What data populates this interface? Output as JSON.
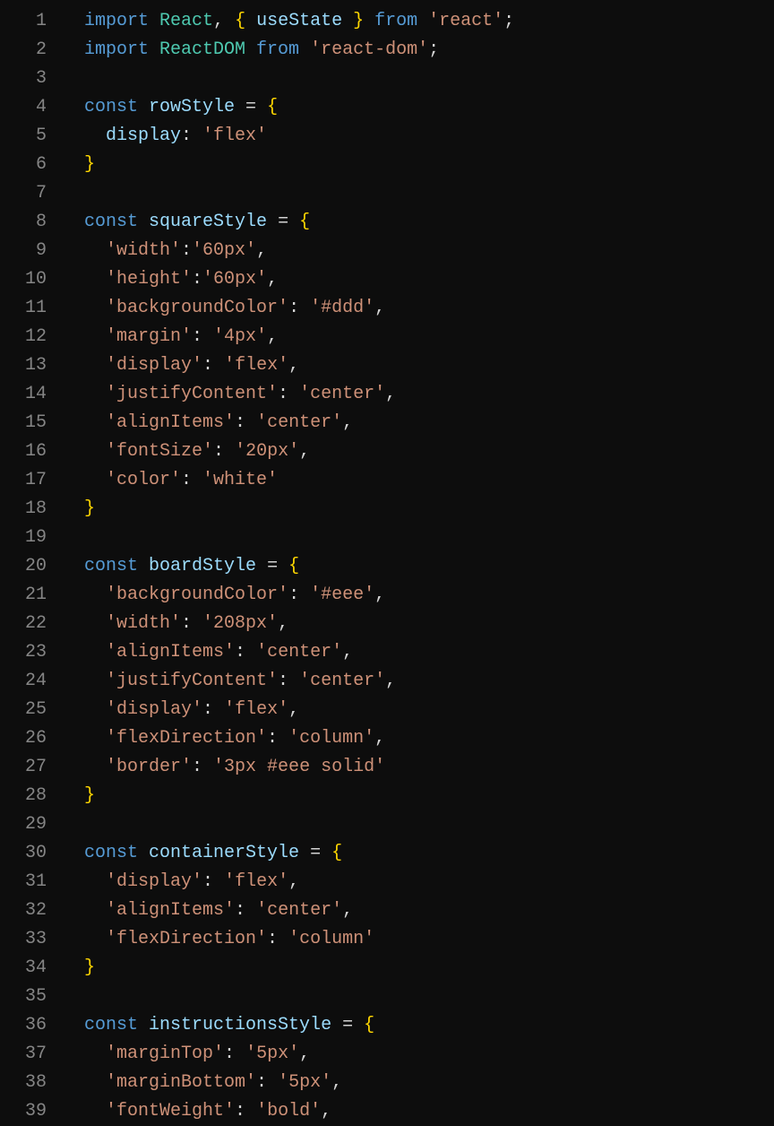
{
  "lines": [
    {
      "n": 1,
      "indent": 0,
      "tokens": [
        {
          "t": "import ",
          "c": "keyword"
        },
        {
          "t": "React",
          "c": "type"
        },
        {
          "t": ", ",
          "c": "punct"
        },
        {
          "t": "{ ",
          "c": "brace"
        },
        {
          "t": "useState",
          "c": "var"
        },
        {
          "t": " }",
          "c": "brace"
        },
        {
          "t": " from ",
          "c": "keyword"
        },
        {
          "t": "'react'",
          "c": "string"
        },
        {
          "t": ";",
          "c": "punct"
        }
      ]
    },
    {
      "n": 2,
      "indent": 0,
      "tokens": [
        {
          "t": "import ",
          "c": "keyword"
        },
        {
          "t": "ReactDOM",
          "c": "type"
        },
        {
          "t": " from ",
          "c": "keyword"
        },
        {
          "t": "'react-dom'",
          "c": "string"
        },
        {
          "t": ";",
          "c": "punct"
        }
      ]
    },
    {
      "n": 3,
      "indent": 0,
      "tokens": []
    },
    {
      "n": 4,
      "indent": 0,
      "tokens": [
        {
          "t": "const ",
          "c": "keyword"
        },
        {
          "t": "rowStyle",
          "c": "var"
        },
        {
          "t": " = ",
          "c": "punct"
        },
        {
          "t": "{",
          "c": "brace"
        }
      ]
    },
    {
      "n": 5,
      "indent": 1,
      "tokens": [
        {
          "t": "display",
          "c": "prop"
        },
        {
          "t": ": ",
          "c": "punct"
        },
        {
          "t": "'flex'",
          "c": "string"
        }
      ]
    },
    {
      "n": 6,
      "indent": 0,
      "tokens": [
        {
          "t": "}",
          "c": "brace"
        }
      ]
    },
    {
      "n": 7,
      "indent": 0,
      "tokens": []
    },
    {
      "n": 8,
      "indent": 0,
      "tokens": [
        {
          "t": "const ",
          "c": "keyword"
        },
        {
          "t": "squareStyle",
          "c": "var"
        },
        {
          "t": " = ",
          "c": "punct"
        },
        {
          "t": "{",
          "c": "brace"
        }
      ]
    },
    {
      "n": 9,
      "indent": 1,
      "tokens": [
        {
          "t": "'width'",
          "c": "string"
        },
        {
          "t": ":",
          "c": "punct"
        },
        {
          "t": "'60px'",
          "c": "string"
        },
        {
          "t": ",",
          "c": "punct"
        }
      ]
    },
    {
      "n": 10,
      "indent": 1,
      "tokens": [
        {
          "t": "'height'",
          "c": "string"
        },
        {
          "t": ":",
          "c": "punct"
        },
        {
          "t": "'60px'",
          "c": "string"
        },
        {
          "t": ",",
          "c": "punct"
        }
      ]
    },
    {
      "n": 11,
      "indent": 1,
      "tokens": [
        {
          "t": "'backgroundColor'",
          "c": "string"
        },
        {
          "t": ": ",
          "c": "punct"
        },
        {
          "t": "'#ddd'",
          "c": "string"
        },
        {
          "t": ",",
          "c": "punct"
        }
      ]
    },
    {
      "n": 12,
      "indent": 1,
      "tokens": [
        {
          "t": "'margin'",
          "c": "string"
        },
        {
          "t": ": ",
          "c": "punct"
        },
        {
          "t": "'4px'",
          "c": "string"
        },
        {
          "t": ",",
          "c": "punct"
        }
      ]
    },
    {
      "n": 13,
      "indent": 1,
      "tokens": [
        {
          "t": "'display'",
          "c": "string"
        },
        {
          "t": ": ",
          "c": "punct"
        },
        {
          "t": "'flex'",
          "c": "string"
        },
        {
          "t": ",",
          "c": "punct"
        }
      ]
    },
    {
      "n": 14,
      "indent": 1,
      "tokens": [
        {
          "t": "'justifyContent'",
          "c": "string"
        },
        {
          "t": ": ",
          "c": "punct"
        },
        {
          "t": "'center'",
          "c": "string"
        },
        {
          "t": ",",
          "c": "punct"
        }
      ]
    },
    {
      "n": 15,
      "indent": 1,
      "tokens": [
        {
          "t": "'alignItems'",
          "c": "string"
        },
        {
          "t": ": ",
          "c": "punct"
        },
        {
          "t": "'center'",
          "c": "string"
        },
        {
          "t": ",",
          "c": "punct"
        }
      ]
    },
    {
      "n": 16,
      "indent": 1,
      "tokens": [
        {
          "t": "'fontSize'",
          "c": "string"
        },
        {
          "t": ": ",
          "c": "punct"
        },
        {
          "t": "'20px'",
          "c": "string"
        },
        {
          "t": ",",
          "c": "punct"
        }
      ]
    },
    {
      "n": 17,
      "indent": 1,
      "tokens": [
        {
          "t": "'color'",
          "c": "string"
        },
        {
          "t": ": ",
          "c": "punct"
        },
        {
          "t": "'white'",
          "c": "string"
        }
      ]
    },
    {
      "n": 18,
      "indent": 0,
      "tokens": [
        {
          "t": "}",
          "c": "brace"
        }
      ]
    },
    {
      "n": 19,
      "indent": 0,
      "tokens": []
    },
    {
      "n": 20,
      "indent": 0,
      "tokens": [
        {
          "t": "const ",
          "c": "keyword"
        },
        {
          "t": "boardStyle",
          "c": "var"
        },
        {
          "t": " = ",
          "c": "punct"
        },
        {
          "t": "{",
          "c": "brace"
        }
      ]
    },
    {
      "n": 21,
      "indent": 1,
      "tokens": [
        {
          "t": "'backgroundColor'",
          "c": "string"
        },
        {
          "t": ": ",
          "c": "punct"
        },
        {
          "t": "'#eee'",
          "c": "string"
        },
        {
          "t": ",",
          "c": "punct"
        }
      ]
    },
    {
      "n": 22,
      "indent": 1,
      "tokens": [
        {
          "t": "'width'",
          "c": "string"
        },
        {
          "t": ": ",
          "c": "punct"
        },
        {
          "t": "'208px'",
          "c": "string"
        },
        {
          "t": ",",
          "c": "punct"
        }
      ]
    },
    {
      "n": 23,
      "indent": 1,
      "tokens": [
        {
          "t": "'alignItems'",
          "c": "string"
        },
        {
          "t": ": ",
          "c": "punct"
        },
        {
          "t": "'center'",
          "c": "string"
        },
        {
          "t": ",",
          "c": "punct"
        }
      ]
    },
    {
      "n": 24,
      "indent": 1,
      "tokens": [
        {
          "t": "'justifyContent'",
          "c": "string"
        },
        {
          "t": ": ",
          "c": "punct"
        },
        {
          "t": "'center'",
          "c": "string"
        },
        {
          "t": ",",
          "c": "punct"
        }
      ]
    },
    {
      "n": 25,
      "indent": 1,
      "tokens": [
        {
          "t": "'display'",
          "c": "string"
        },
        {
          "t": ": ",
          "c": "punct"
        },
        {
          "t": "'flex'",
          "c": "string"
        },
        {
          "t": ",",
          "c": "punct"
        }
      ]
    },
    {
      "n": 26,
      "indent": 1,
      "tokens": [
        {
          "t": "'flexDirection'",
          "c": "string"
        },
        {
          "t": ": ",
          "c": "punct"
        },
        {
          "t": "'column'",
          "c": "string"
        },
        {
          "t": ",",
          "c": "punct"
        }
      ]
    },
    {
      "n": 27,
      "indent": 1,
      "tokens": [
        {
          "t": "'border'",
          "c": "string"
        },
        {
          "t": ": ",
          "c": "punct"
        },
        {
          "t": "'3px #eee solid'",
          "c": "string"
        }
      ]
    },
    {
      "n": 28,
      "indent": 0,
      "tokens": [
        {
          "t": "}",
          "c": "brace"
        }
      ]
    },
    {
      "n": 29,
      "indent": 0,
      "tokens": []
    },
    {
      "n": 30,
      "indent": 0,
      "tokens": [
        {
          "t": "const ",
          "c": "keyword"
        },
        {
          "t": "containerStyle",
          "c": "var"
        },
        {
          "t": " = ",
          "c": "punct"
        },
        {
          "t": "{",
          "c": "brace"
        }
      ]
    },
    {
      "n": 31,
      "indent": 1,
      "tokens": [
        {
          "t": "'display'",
          "c": "string"
        },
        {
          "t": ": ",
          "c": "punct"
        },
        {
          "t": "'flex'",
          "c": "string"
        },
        {
          "t": ",",
          "c": "punct"
        }
      ]
    },
    {
      "n": 32,
      "indent": 1,
      "tokens": [
        {
          "t": "'alignItems'",
          "c": "string"
        },
        {
          "t": ": ",
          "c": "punct"
        },
        {
          "t": "'center'",
          "c": "string"
        },
        {
          "t": ",",
          "c": "punct"
        }
      ]
    },
    {
      "n": 33,
      "indent": 1,
      "tokens": [
        {
          "t": "'flexDirection'",
          "c": "string"
        },
        {
          "t": ": ",
          "c": "punct"
        },
        {
          "t": "'column'",
          "c": "string"
        }
      ]
    },
    {
      "n": 34,
      "indent": 0,
      "tokens": [
        {
          "t": "}",
          "c": "brace"
        }
      ]
    },
    {
      "n": 35,
      "indent": 0,
      "tokens": []
    },
    {
      "n": 36,
      "indent": 0,
      "tokens": [
        {
          "t": "const ",
          "c": "keyword"
        },
        {
          "t": "instructionsStyle",
          "c": "var"
        },
        {
          "t": " = ",
          "c": "punct"
        },
        {
          "t": "{",
          "c": "brace"
        }
      ]
    },
    {
      "n": 37,
      "indent": 1,
      "tokens": [
        {
          "t": "'marginTop'",
          "c": "string"
        },
        {
          "t": ": ",
          "c": "punct"
        },
        {
          "t": "'5px'",
          "c": "string"
        },
        {
          "t": ",",
          "c": "punct"
        }
      ]
    },
    {
      "n": 38,
      "indent": 1,
      "tokens": [
        {
          "t": "'marginBottom'",
          "c": "string"
        },
        {
          "t": ": ",
          "c": "punct"
        },
        {
          "t": "'5px'",
          "c": "string"
        },
        {
          "t": ",",
          "c": "punct"
        }
      ]
    },
    {
      "n": 39,
      "indent": 1,
      "tokens": [
        {
          "t": "'fontWeight'",
          "c": "string"
        },
        {
          "t": ": ",
          "c": "punct"
        },
        {
          "t": "'bold'",
          "c": "string"
        },
        {
          "t": ",",
          "c": "punct"
        }
      ]
    }
  ]
}
